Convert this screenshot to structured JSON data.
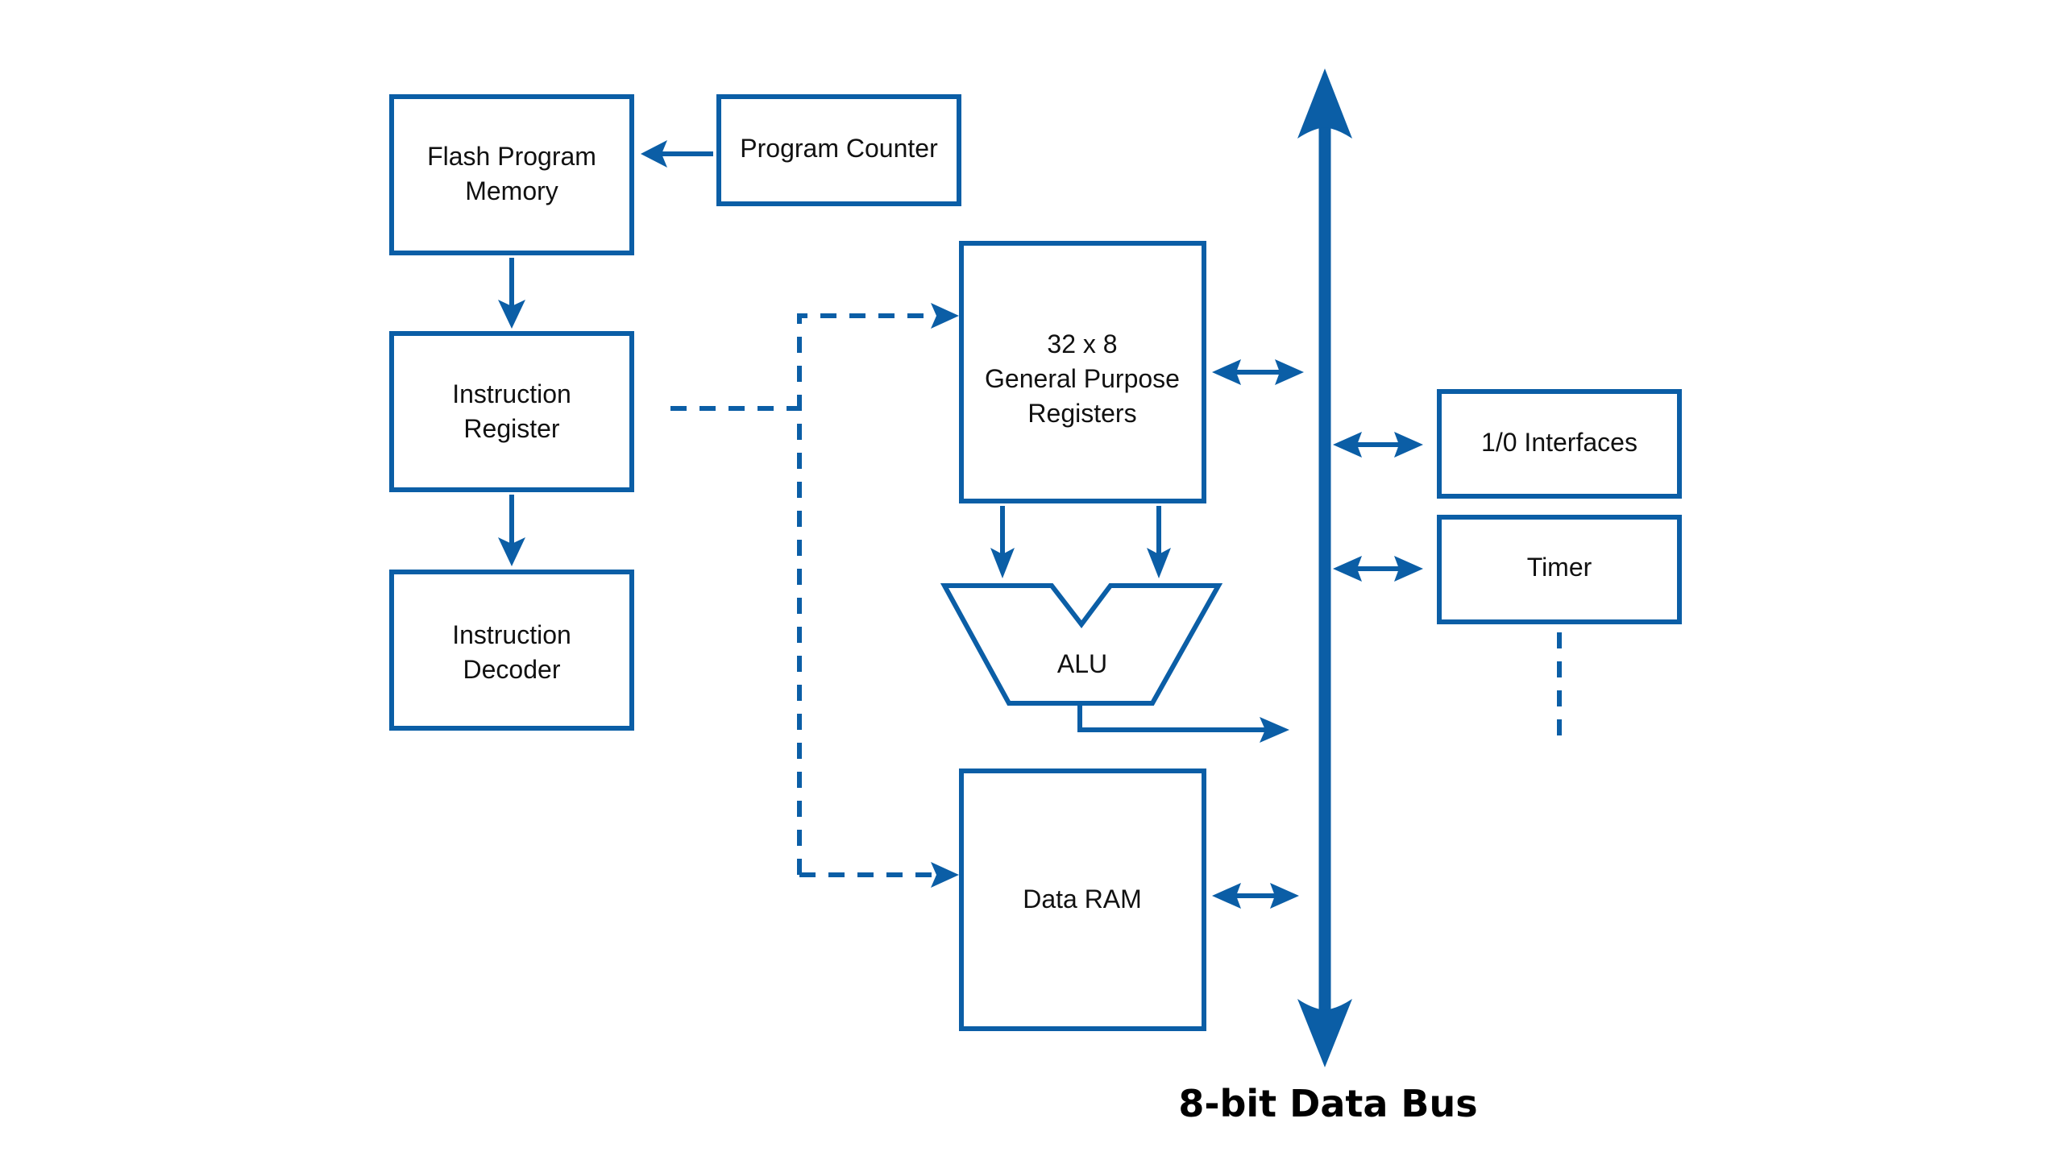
{
  "diagram": {
    "accent_color": "#0b5ea6",
    "blocks": {
      "flash_memory": [
        "Flash Program",
        "Memory"
      ],
      "program_counter": [
        "Program Counter"
      ],
      "instruction_register": [
        "Instruction",
        "Register"
      ],
      "instruction_decoder": [
        "Instruction",
        "Decoder"
      ],
      "gpr": [
        "32 x 8",
        "General Purpose",
        "Registers"
      ],
      "alu": [
        "ALU"
      ],
      "data_ram": [
        "Data RAM"
      ],
      "io_interfaces": [
        "1/0 Interfaces"
      ],
      "timer": [
        "Timer"
      ]
    },
    "bus_label": "8-bit Data Bus"
  }
}
